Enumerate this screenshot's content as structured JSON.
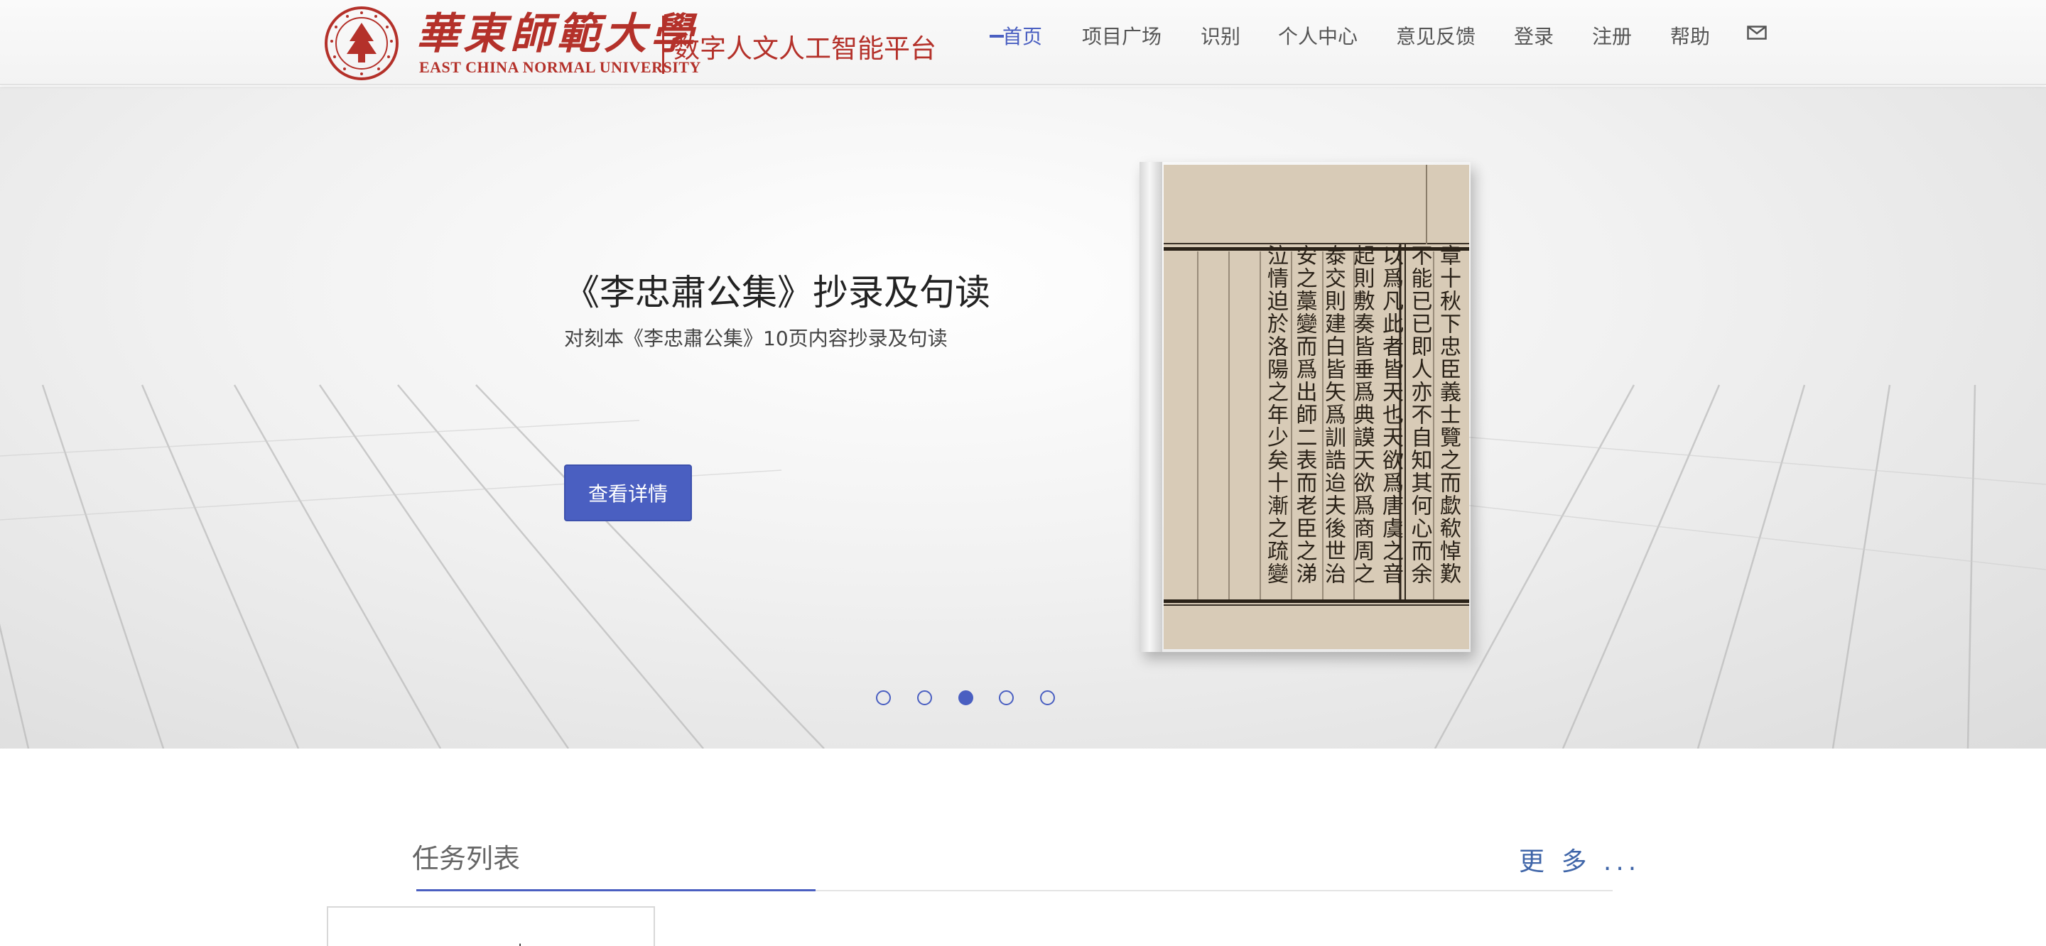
{
  "header": {
    "logo": {
      "university_cn": "華東師範大學",
      "university_en": "EAST CHINA NORMAL UNIVERSITY",
      "platform_name": "数字人文人工智能平台"
    },
    "nav": [
      {
        "label": "首页",
        "active": true
      },
      {
        "label": "项目广场",
        "active": false
      },
      {
        "label": "识别",
        "active": false
      },
      {
        "label": "个人中心",
        "active": false
      },
      {
        "label": "意见反馈",
        "active": false
      },
      {
        "label": "登录",
        "active": false
      },
      {
        "label": "注册",
        "active": false
      },
      {
        "label": "帮助",
        "active": false
      }
    ],
    "mail_icon": "envelope-icon"
  },
  "hero": {
    "title": "《李忠肅公集》抄录及句读",
    "subtitle": "对刻本《李忠肅公集》10页内容抄录及句读",
    "button_label": "查看详情",
    "book_image": {
      "columns": [
        "章十秋下忠臣義士覽之而歔欷悼歎",
        "不能已已即人亦不自知其何心而余",
        "以爲凡此者皆天也天欲爲唐虞之音",
        "起則敷奏皆垂爲典謨天欲爲商周之",
        "泰交則建白皆矢爲訓誥迨夫後世治",
        "安之藁變而爲出師二表而老臣之涕",
        "泣情迫於洛陽之年少矣十漸之疏變"
      ]
    },
    "carousel": {
      "total": 5,
      "active_index": 2
    }
  },
  "tasks": {
    "title": "任务列表",
    "more_label": "更 多 ...",
    "first_card_glyph": "ㅗ"
  },
  "colors": {
    "accent": "#4a5fc1",
    "brand_red": "#b4312a",
    "link_blue": "#3f65a8"
  }
}
